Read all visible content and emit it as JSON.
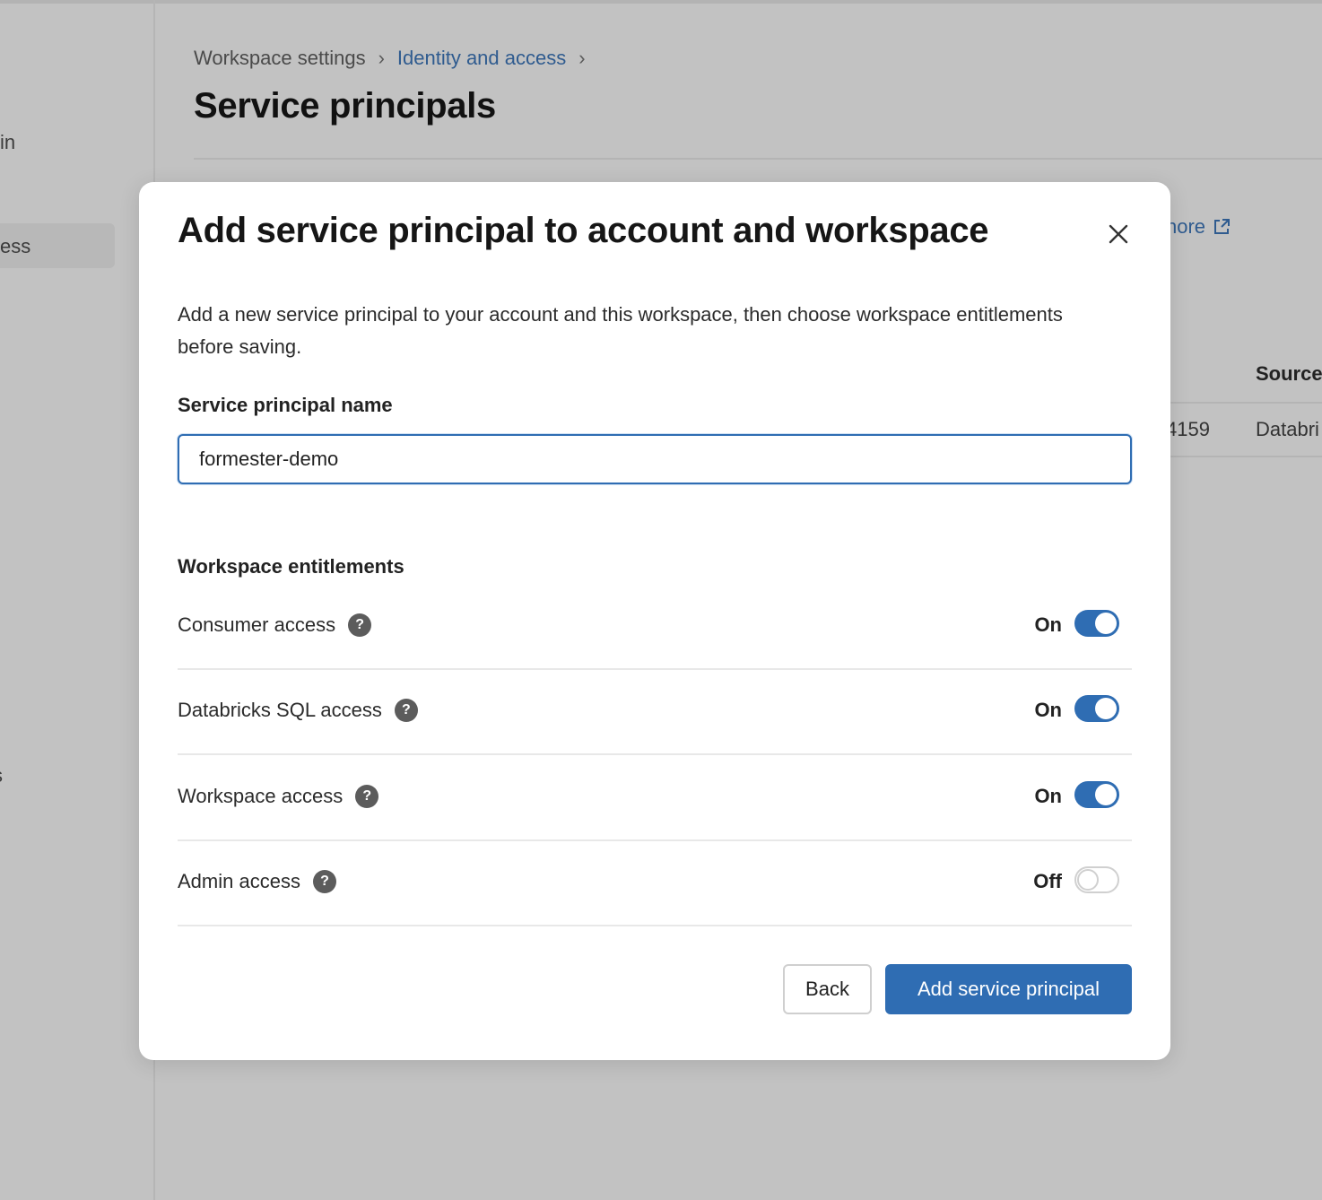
{
  "background": {
    "sidebar_fragments": [
      "in",
      "ess",
      "s"
    ],
    "breadcrumb": {
      "item1": "Workspace settings",
      "item2": "Identity and access",
      "separator": "›"
    },
    "page_title": "Service principals",
    "learn_more_fragment": "nore",
    "table": {
      "column_source": "Source",
      "row_id_fragment": "4159",
      "row_source_fragment": "Databri"
    }
  },
  "modal": {
    "title": "Add service principal to account and workspace",
    "description": "Add a new service principal to your account and this workspace, then choose workspace entitlements before saving.",
    "name_label": "Service principal name",
    "name_value": "formester-demo",
    "entitlements_label": "Workspace entitlements",
    "entitlements": [
      {
        "label": "Consumer access",
        "state": "On",
        "enabled": true
      },
      {
        "label": "Databricks SQL access",
        "state": "On",
        "enabled": true
      },
      {
        "label": "Workspace access",
        "state": "On",
        "enabled": true
      },
      {
        "label": "Admin access",
        "state": "Off",
        "enabled": false
      }
    ],
    "help_glyph": "?",
    "back_label": "Back",
    "submit_label": "Add service principal"
  },
  "colors": {
    "accent": "#2f6db3",
    "link": "#2f5b8f",
    "overlay": "#c2c2c2"
  }
}
